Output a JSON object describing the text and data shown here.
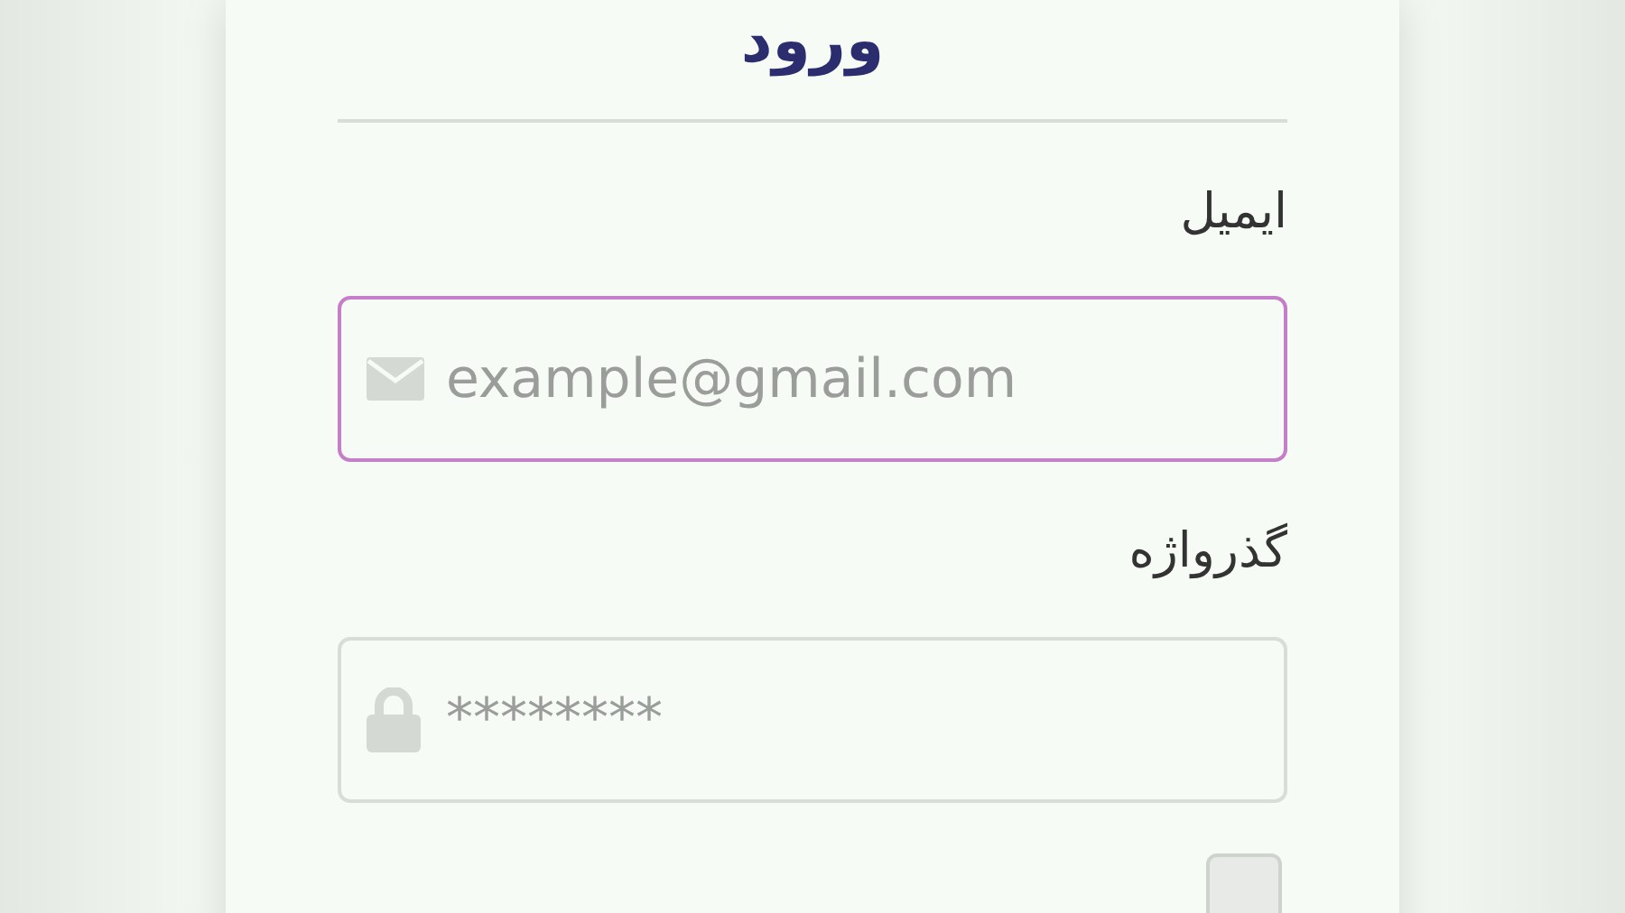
{
  "title": "ورود",
  "fields": [
    {
      "label": "ایمیل",
      "placeholder": "example@gmail.com",
      "kind": "email",
      "focused": true
    },
    {
      "label": "گذرواژه",
      "placeholder": "********",
      "kind": "password",
      "focused": false
    }
  ],
  "remember": {
    "checked": false
  }
}
